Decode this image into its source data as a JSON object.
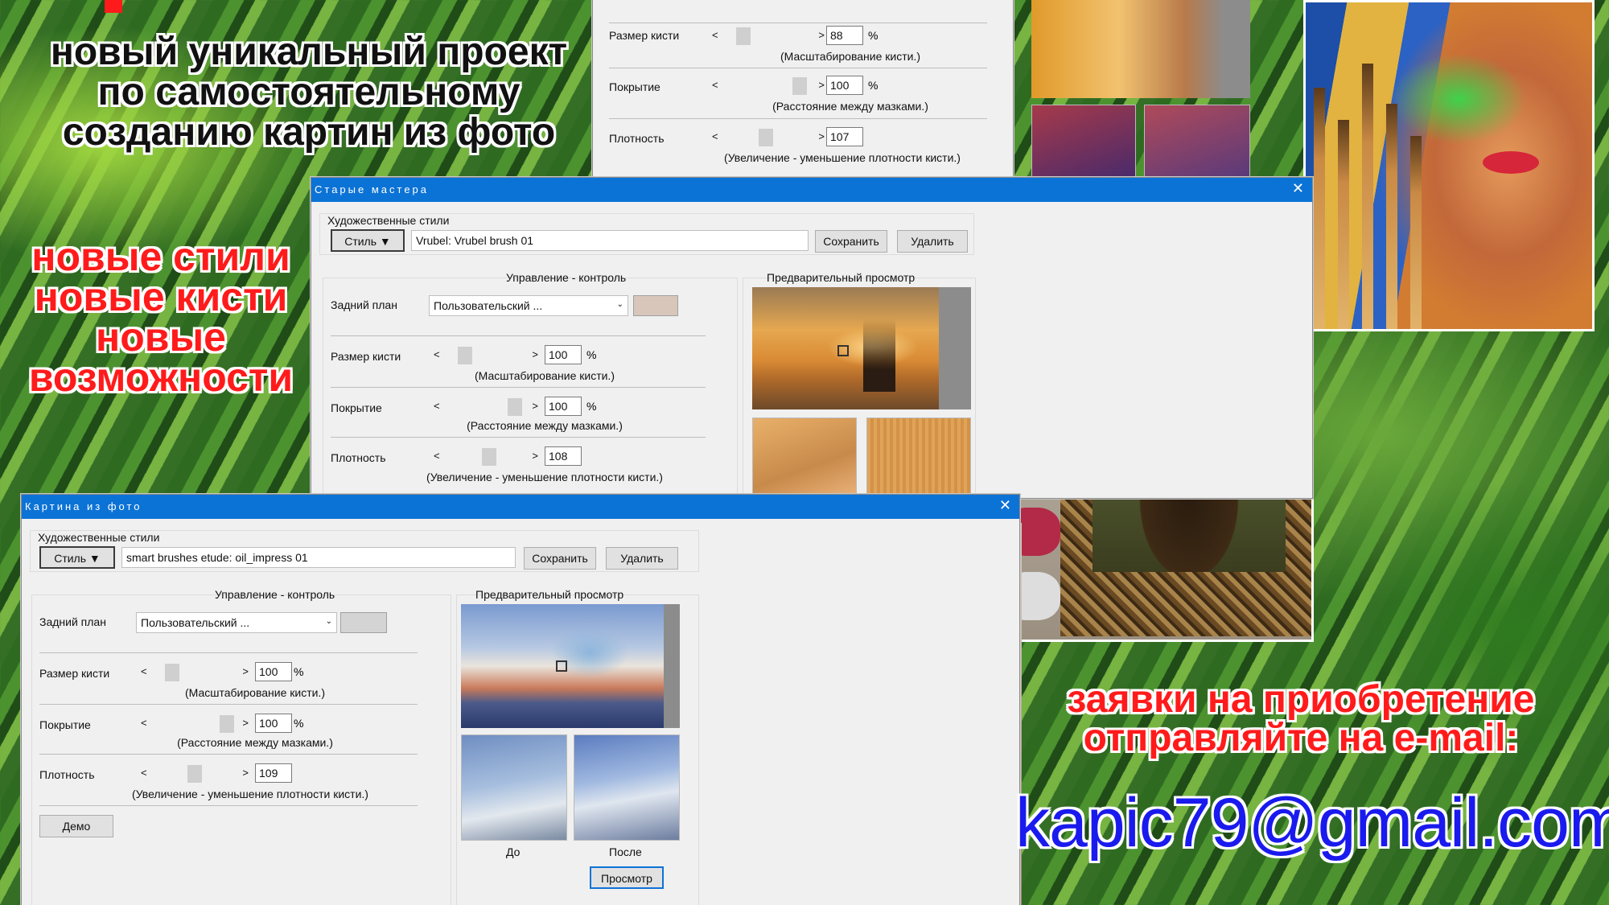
{
  "headline": {
    "lines": [
      "новый уникальный проект",
      "по самостоятельному",
      "созданию картин из фото"
    ]
  },
  "features": {
    "lines": [
      "новые стили",
      "новые кисти",
      "новые",
      "возможности"
    ]
  },
  "order": {
    "lines": [
      "заявки на приобретение",
      "отправляйте на e-mail:"
    ],
    "email": "kapic79@gmail.com"
  },
  "win_top": {
    "rows": [
      {
        "label": "Размер кисти",
        "value": "88",
        "unit": "%",
        "note": "(Масштабирование кисти.)"
      },
      {
        "label": "Покрытие",
        "value": "100",
        "unit": "%",
        "note": "(Расстояние между мазками.)"
      },
      {
        "label": "Плотность",
        "value": "107",
        "note": "(Увеличение - уменьшение плотности кисти.)"
      }
    ]
  },
  "win_old_masters": {
    "title": "Старые мастера",
    "close": "✕",
    "styles_label": "Художественные стили",
    "style_button": "Стиль",
    "style_value": "Vrubel: Vrubel brush 01",
    "save": "Сохранить",
    "delete": "Удалить",
    "control_header": "Управление - контроль",
    "preview_header": "Предварительный просмотр",
    "background_label": "Задний план",
    "background_value": "Пользовательский ...",
    "swatch_color": "#d8c6bb",
    "rows": [
      {
        "label": "Размер кисти",
        "value": "100",
        "unit": "%",
        "note": "(Масштабирование кисти.)"
      },
      {
        "label": "Покрытие",
        "value": "100",
        "unit": "%",
        "note": "(Расстояние между мазками.)"
      },
      {
        "label": "Плотность",
        "value": "108",
        "note": "(Увеличение - уменьшение плотности кисти.)"
      }
    ]
  },
  "win_photo": {
    "title": "Картина из фото",
    "close": "✕",
    "styles_label": "Художественные стили",
    "style_button": "Стиль",
    "style_value": "smart brushes etude: oil_impress 01",
    "save": "Сохранить",
    "delete": "Удалить",
    "control_header": "Управление - контроль",
    "preview_header": "Предварительный просмотр",
    "background_label": "Задний план",
    "background_value": "Пользовательский ...",
    "swatch_color": "#d4d4d4",
    "rows": [
      {
        "label": "Размер кисти",
        "value": "100",
        "unit": "%",
        "note": "(Масштабирование кисти.)"
      },
      {
        "label": "Покрытие",
        "value": "100",
        "unit": "%",
        "note": "(Расстояние между мазками.)"
      },
      {
        "label": "Плотность",
        "value": "109",
        "note": "(Увеличение - уменьшение плотности кисти.)"
      }
    ],
    "demo": "Демо",
    "before": "До",
    "after": "После",
    "preview_button": "Просмотр"
  },
  "colors": {
    "title_bar": "#0c73d6",
    "headline_red": "#ff1b1b",
    "email_blue": "#1a1aee",
    "window_bg": "#f0f0f0"
  },
  "icons": {
    "close": "close-icon",
    "dropdown": "caret-down-icon",
    "slider_left": "chevron-left-icon",
    "slider_right": "chevron-right-icon"
  }
}
